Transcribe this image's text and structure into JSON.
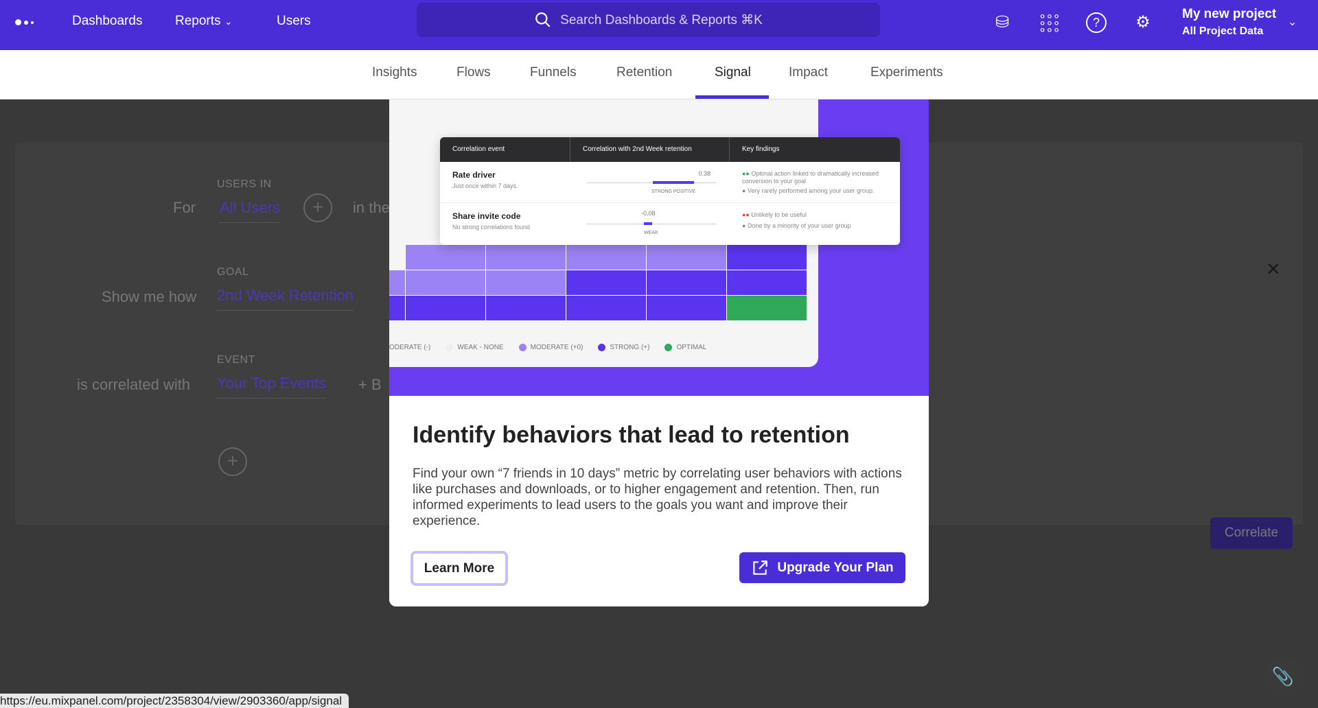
{
  "topbar": {
    "nav": [
      "Dashboards",
      "Reports",
      "Users"
    ],
    "search_placeholder": "Search Dashboards & Reports ⌘K",
    "project_name": "My new project",
    "project_scope": "All Project Data",
    "icons": [
      "database-settings-icon",
      "apps-grid-icon",
      "help-icon",
      "settings-gear-icon"
    ],
    "brand_color": "#4a2dd6"
  },
  "tabs": [
    "Insights",
    "Flows",
    "Funnels",
    "Retention",
    "Signal",
    "Impact",
    "Experiments"
  ],
  "active_tab": "Signal",
  "query": {
    "users_in_label": "USERS IN",
    "for_label": "For",
    "users_value": "All Users",
    "in_the_label": "in the",
    "goal_label": "GOAL",
    "show_me_how": "Show me how",
    "goal_value": "2nd Week Retention",
    "event_label": "EVENT",
    "correlated_with": "is correlated with",
    "event_value": "Your Top Events",
    "add_label": "+ B",
    "correlate_button": "Correlate"
  },
  "modal": {
    "preview": {
      "headers": [
        "Correlation event",
        "Correlation with 2nd Week retention",
        "Key findings"
      ],
      "rows": [
        {
          "event": "Rate driver",
          "sub": "Just once within 7 days.",
          "value": "0.38",
          "strength": "STRONG POSITIVE",
          "fill": 0.38,
          "findings": [
            "Optimal action linked to dramatically increased conversion to your goal",
            "Very rarely performed among your user group."
          ],
          "dot": "#2fa85a"
        },
        {
          "event": "Share invite code",
          "sub": "No strong correlations found",
          "value": "-0.08",
          "strength": "WEAK",
          "fill": 0.08,
          "findings": [
            "Unlikely to be useful",
            "Done by a minority of your user group"
          ],
          "dot": "#e0463e"
        }
      ],
      "legend": [
        {
          "label": "ODERATE (-)",
          "color": "#f5f5f5"
        },
        {
          "label": "WEAK - NONE",
          "color": "#eeeeee"
        },
        {
          "label": "MODERATE (+0)",
          "color": "#9b82f5"
        },
        {
          "label": "STRONG (+)",
          "color": "#5b34ef"
        },
        {
          "label": "OPTIMAL",
          "color": "#2fa85a"
        }
      ]
    },
    "title": "Identify behaviors that lead to retention",
    "body": "Find your own “7 friends in 10 days” metric by correlating user behaviors with actions like purchases and downloads, or to higher engagement and retention. Then, run informed experiments to lead users to the goals you want and improve their experience.",
    "learn_more": "Learn More",
    "upgrade": "Upgrade Your Plan"
  },
  "status_url": "https://eu.mixpanel.com/project/2358304/view/2903360/app/signal"
}
